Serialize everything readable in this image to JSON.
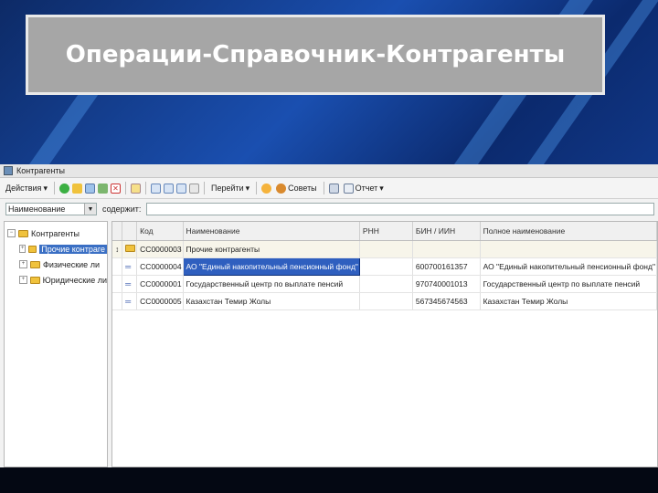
{
  "slide": {
    "title": "Операции-Справочник-Контрагенты"
  },
  "window": {
    "title": "Контрагенты"
  },
  "toolbar": {
    "actions_label": "Действия",
    "goto_label": "Перейти",
    "advice_label": "Советы",
    "report_label": "Отчет"
  },
  "filter": {
    "field_value": "Наименование",
    "search_label": "содержит:",
    "search_value": ""
  },
  "tree": {
    "root": "Контрагенты",
    "items": [
      "Прочие контраге",
      "Физические ли",
      "Юридические ли"
    ]
  },
  "table": {
    "columns": [
      "Код",
      "Наименование",
      "РНН",
      "БИН / ИИН",
      "Полное наименование"
    ],
    "rows": [
      {
        "type": "group",
        "code": "СС0000003",
        "name": "Прочие контрагенты",
        "rnn": "",
        "bin": "",
        "full": ""
      },
      {
        "type": "item",
        "code": "СС0000004",
        "name": "АО \"Единый накопительный пенсионный фонд\"",
        "rnn": "",
        "bin": "600700161357",
        "full": "АО \"Единый накопительный пенсионный фонд\""
      },
      {
        "type": "item",
        "code": "СС0000001",
        "name": "Государственный центр по выплате пенсий",
        "rnn": "",
        "bin": "970740001013",
        "full": "Государственный центр по выплате пенсий"
      },
      {
        "type": "item",
        "code": "СС0000005",
        "name": "Казахстан Темир Жолы",
        "rnn": "",
        "bin": "567345674563",
        "full": "Казахстан Темир Жолы"
      }
    ]
  },
  "colors": {
    "selection": "#2f5fbf",
    "folder": "#f0c23c",
    "title_bg": "#a6a6a6"
  }
}
